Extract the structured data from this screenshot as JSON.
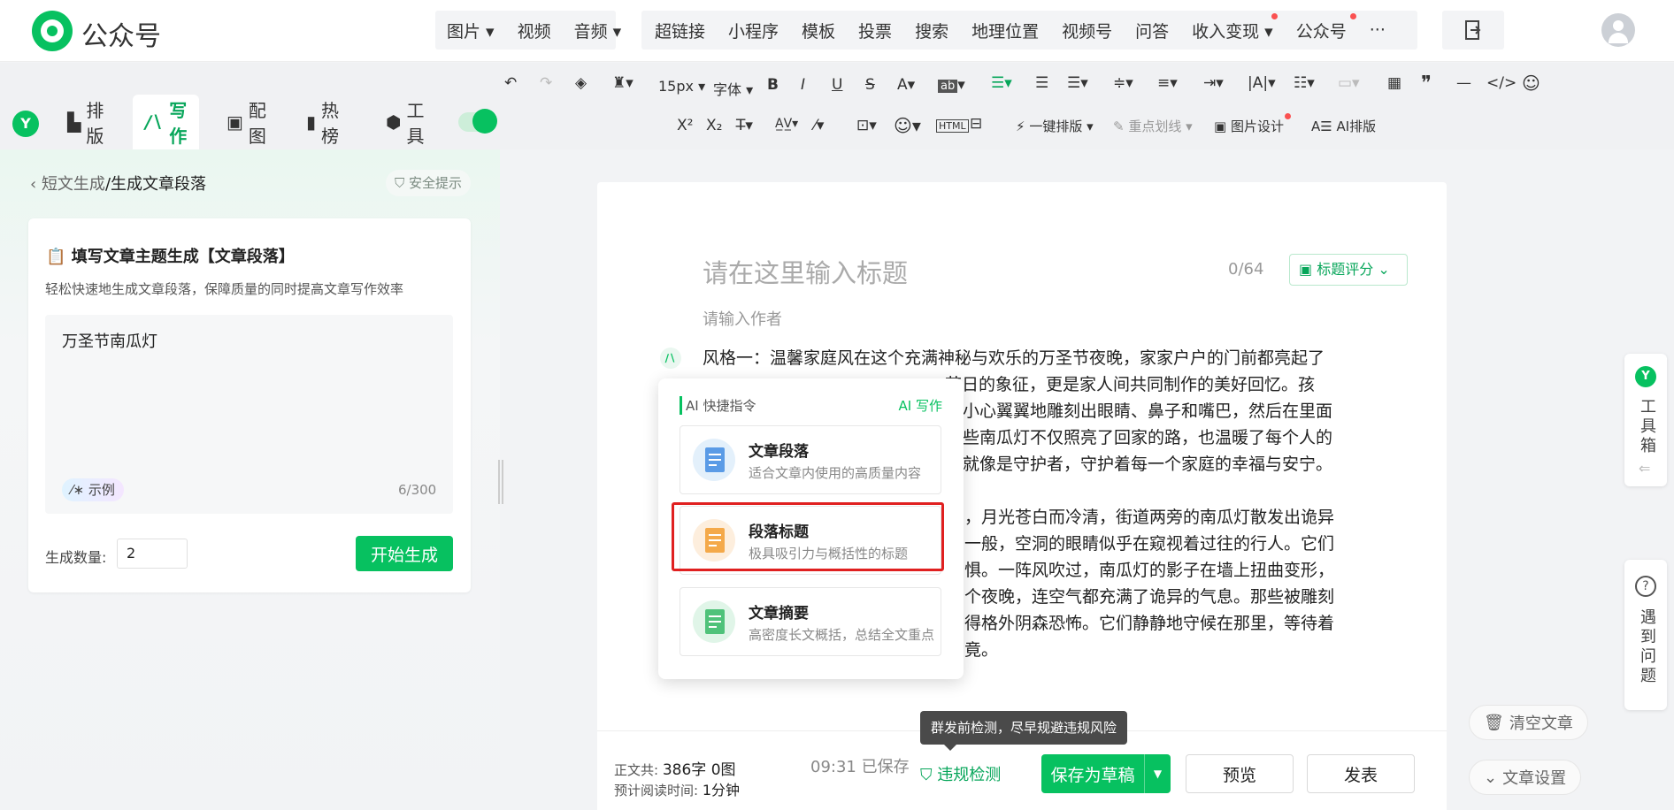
{
  "header": {
    "app_title": "公众号",
    "media_menu": [
      "图片",
      "视频",
      "音频"
    ],
    "insert_menu": [
      "超链接",
      "小程序",
      "模板",
      "投票",
      "搜索",
      "地理位置",
      "视频号",
      "问答",
      "收入变现",
      "公众号",
      "···"
    ]
  },
  "toolbar": {
    "font_size": "15px",
    "font_family": "字体",
    "one_click_layout": "一键排版",
    "highlight": "重点划线",
    "image_design": "图片设计",
    "ai_layout": "AI排版"
  },
  "plugin_tabs": [
    "排版",
    "写作",
    "配图",
    "热榜",
    "工具"
  ],
  "left_panel": {
    "breadcrumb_back": "短文生成",
    "breadcrumb_current": "/生成文章段落",
    "safety_tip": "安全提示",
    "card_title": "填写文章主题生成【文章段落】",
    "card_desc": "轻松快速地生成文章段落，保障质量的同时提高文章写作效率",
    "topic_value": "万圣节南瓜灯",
    "example_label": "示例",
    "char_count": "6/300",
    "quantity_label": "生成数量:",
    "quantity_value": "2",
    "generate_button": "开始生成"
  },
  "editor": {
    "title_placeholder": "请在这里输入标题",
    "title_count": "0/64",
    "title_score": "标题评分",
    "author_placeholder": "请输入作者",
    "paragraph1": [
      "风格一：温馨家庭风在这个充满神秘与欢乐的万圣节夜晚，家家户户的门前都亮起了",
      "小心翼翼地雕刻出眼睛、鼻子和嘴巴，然后在里面",
      "些南瓜灯不仅照亮了回家的路，也温暖了每个人的",
      "就像是守护者，守护着每一个家庭的幸福与安宁。"
    ],
    "paragraph1_line2_tail": "节日的象征，更是家人间共同制作的美好回忆。孩",
    "paragraph2": [
      "，月光苍白而冷清，街道两旁的南瓜灯散发出诡异",
      "一般，空洞的眼睛似乎在窥视着过往的行人。它们",
      "惧。一阵风吹过，南瓜灯的影子在墙上扭曲变形，",
      "个夜晚，连空气都充满了诡异的气息。那些被雕刻",
      "得格外阴森恐怖。它们静静地守候在那里，等待着",
      "竟。"
    ]
  },
  "ai_popup": {
    "header": "AI 快捷指令",
    "brand": "AI 写作",
    "items": [
      {
        "title": "文章段落",
        "desc": "适合文章内使用的高质量内容"
      },
      {
        "title": "段落标题",
        "desc": "极具吸引力与概括性的标题"
      },
      {
        "title": "文章摘要",
        "desc": "高密度长文概括，总结全文重点"
      }
    ]
  },
  "side_tools": {
    "toolbox": "工具箱",
    "faq": "遇到问题",
    "clear_article": "清空文章",
    "article_settings": "文章设置"
  },
  "footer": {
    "word_count_label": "正文共:",
    "word_count": "386字 0图",
    "read_time_label": "预计阅读时间:",
    "read_time": "1分钟",
    "saved_time": "09:31",
    "saved_status": "已保存",
    "tooltip": "群发前检测，尽早规避违规风险",
    "violation_check": "违规检测",
    "save_draft": "保存为草稿",
    "preview": "预览",
    "publish": "发表"
  },
  "colors": {
    "brand_green": "#07c160",
    "highlight_red": "#e02020"
  }
}
